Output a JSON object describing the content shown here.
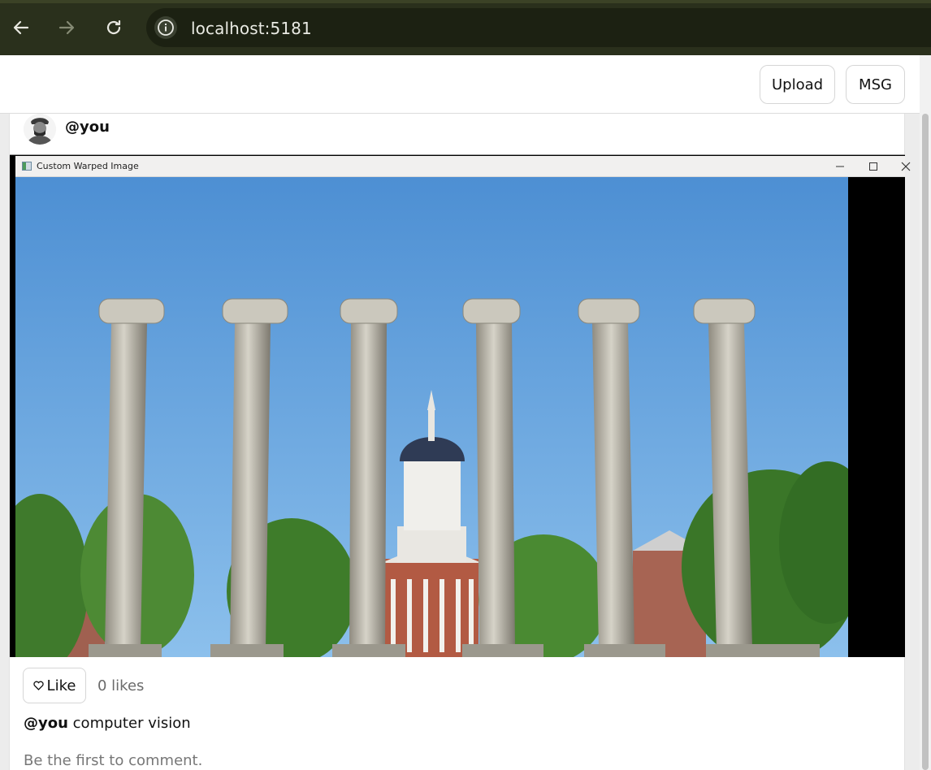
{
  "browser": {
    "url": "localhost:5181",
    "icons": [
      "back-arrow-icon",
      "forward-arrow-icon",
      "reload-icon",
      "site-info-icon"
    ]
  },
  "header": {
    "upload_label": "Upload",
    "msg_label": "MSG"
  },
  "post": {
    "username": "@you",
    "image_window_title": "Custom Warped Image",
    "like_label": "Like",
    "likes_text": "0 likes",
    "caption_user": "@you",
    "caption_text": "computer vision",
    "comment_placeholder": "Be the first to comment."
  },
  "colors": {
    "chrome_bg": "#2a301c",
    "sky": "#5b9ad8",
    "column": "#b7b4a8"
  }
}
